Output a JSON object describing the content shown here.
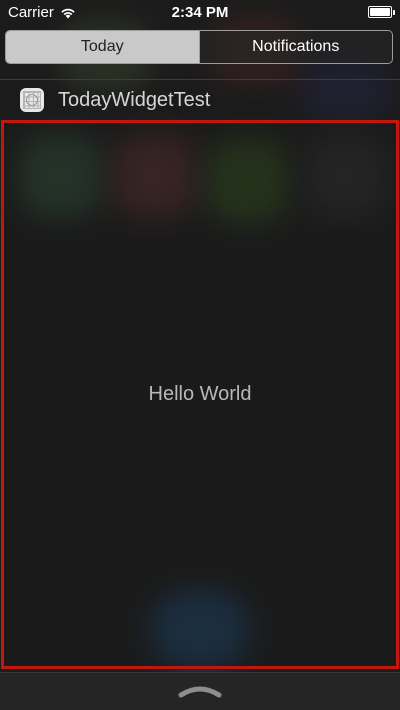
{
  "status_bar": {
    "carrier": "Carrier",
    "time": "2:34 PM",
    "wifi_icon": "wifi-icon",
    "battery_icon": "battery-icon",
    "battery_level": 1.0
  },
  "tabs": [
    {
      "label": "Today",
      "selected": true
    },
    {
      "label": "Notifications",
      "selected": false
    }
  ],
  "widget": {
    "icon": "app-icon",
    "title": "TodayWidgetTest",
    "content_text": "Hello World",
    "highlight_color": "#c3160c"
  },
  "bottom": {
    "grabber_icon": "chevron-up-icon"
  }
}
